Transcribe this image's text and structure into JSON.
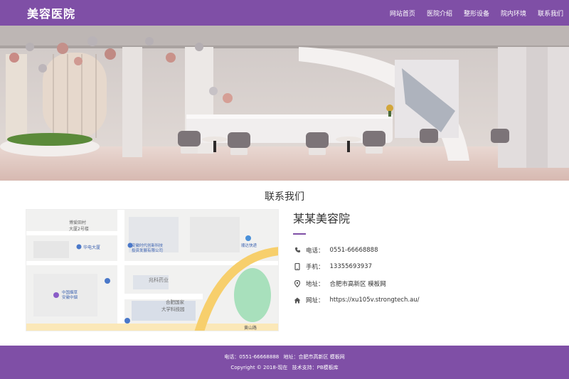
{
  "header": {
    "logo": "美容医院",
    "nav": [
      "网站首页",
      "医院介绍",
      "整形设备",
      "院内环境",
      "联系我们"
    ]
  },
  "section": {
    "title": "联系我们"
  },
  "map": {
    "labels": {
      "l1": "博爱田村",
      "l2": "大厦2号楼",
      "l3": "华电大厦",
      "l4": "安徽时代创新科技",
      "l5": "投资发展有限公司",
      "l6": "顺达快递",
      "l7": "兆科药业",
      "l8": "中国烟草",
      "l9": "安徽中烟",
      "l10": "合肥国家",
      "l11": "大学科技园",
      "l12": "黄山路"
    }
  },
  "contact": {
    "company": "某某美容院",
    "phone_label": "电话：",
    "phone": "0551-66668888",
    "mobile_label": "手机：",
    "mobile": "13355693937",
    "address_label": "地址：",
    "address": "合肥市高新区 模板网",
    "website_label": "网址：",
    "website": "https://xu105v.strongtech.au/"
  },
  "footer": {
    "line1_phone": "电话：0551-66668888",
    "line1_address": "地址：合肥市高新区 模板网",
    "line2_copyright": "Copyright © 2018-现在",
    "line2_support": "技术支持：PB模板库"
  },
  "colors": {
    "brand": "#7f4fa6",
    "text": "#333333"
  },
  "icons": [
    "phone-icon",
    "mobile-icon",
    "location-icon",
    "home-icon"
  ]
}
